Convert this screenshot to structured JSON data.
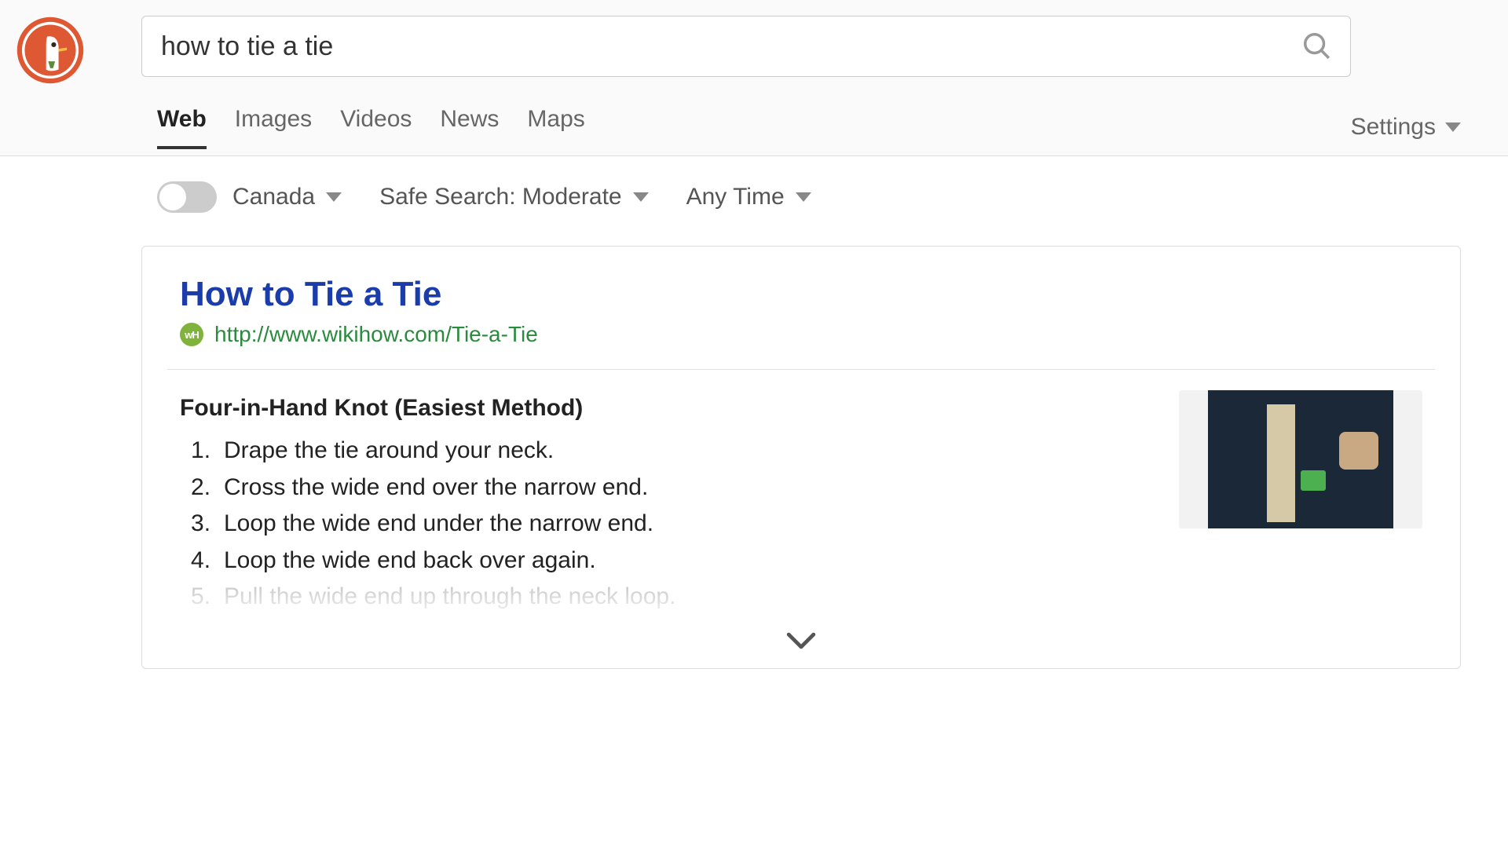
{
  "search": {
    "query": "how to tie a tie"
  },
  "tabs": {
    "items": [
      {
        "label": "Web",
        "active": true
      },
      {
        "label": "Images",
        "active": false
      },
      {
        "label": "Videos",
        "active": false
      },
      {
        "label": "News",
        "active": false
      },
      {
        "label": "Maps",
        "active": false
      }
    ],
    "settings_label": "Settings"
  },
  "filters": {
    "region": "Canada",
    "safe_search": "Safe Search: Moderate",
    "time": "Any Time"
  },
  "result": {
    "title": "How to Tie a Tie",
    "source_favicon_text": "wH",
    "url": "http://www.wikihow.com/Tie-a-Tie",
    "method_title": "Four-in-Hand Knot (Easiest Method)",
    "steps": [
      "Drape the tie around your neck.",
      "Cross the wide end over the narrow end.",
      "Loop the wide end under the narrow end.",
      "Loop the wide end back over again.",
      "Pull the wide end up through the neck loop."
    ]
  }
}
